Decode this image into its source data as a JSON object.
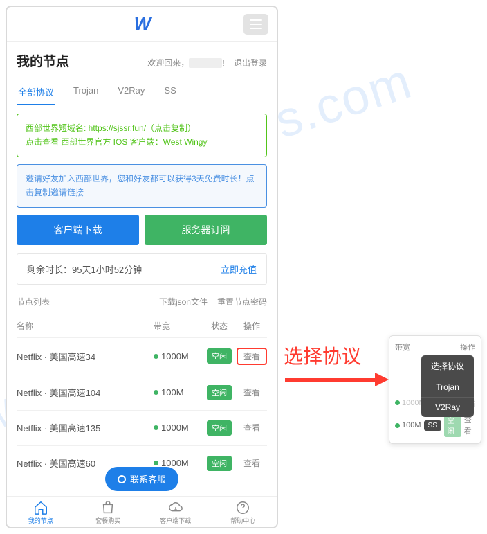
{
  "header": {
    "logo_text": "W"
  },
  "page": {
    "title": "我的节点",
    "welcome_prefix": "欢迎回来，",
    "logout": "退出登录"
  },
  "tabs": [
    {
      "label": "全部协议",
      "active": true
    },
    {
      "label": "Trojan",
      "active": false
    },
    {
      "label": "V2Ray",
      "active": false
    },
    {
      "label": "SS",
      "active": false
    }
  ],
  "info_green": {
    "line1_prefix": "西部世界短域名: ",
    "line1_link": "https://sjssr.fun/",
    "line1_suffix": "（点击复制）",
    "line2": "点击查看 西部世界官方 IOS 客户端：West Wingy"
  },
  "info_blue": "邀请好友加入西部世界，您和好友都可以获得3天免费时长！点击复制邀请链接",
  "buttons": {
    "download": "客户端下载",
    "subscribe": "服务器订阅"
  },
  "balance": {
    "label": "剩余时长：",
    "value": "95天1小时52分钟",
    "action": "立即充值"
  },
  "list": {
    "title": "节点列表",
    "link_json": "下载json文件",
    "link_reset": "重置节点密码",
    "col_name": "名称",
    "col_bw": "带宽",
    "col_status": "状态",
    "col_action": "操作",
    "status_idle": "空闲",
    "view": "查看",
    "nodes": [
      {
        "name": "Netflix · 美国高速34",
        "bw": "1000M",
        "highlight": true
      },
      {
        "name": "Netflix · 美国高速104",
        "bw": "100M",
        "highlight": false
      },
      {
        "name": "Netflix · 美国高速135",
        "bw": "1000M",
        "highlight": false
      },
      {
        "name": "Netflix · 美国高速60",
        "bw": "1000M",
        "highlight": false
      }
    ]
  },
  "contact": "联系客服",
  "bottom_nav": [
    {
      "label": "我的节点",
      "active": true
    },
    {
      "label": "套餐购买",
      "active": false
    },
    {
      "label": "客户端下载",
      "active": false
    },
    {
      "label": "帮助中心",
      "active": false
    }
  ],
  "annotation": {
    "label": "选择协议"
  },
  "popup": {
    "col_bw": "带宽",
    "col_action": "操作",
    "dropdown_title": "选择协议",
    "options": [
      "Trojan",
      "V2Ray",
      "SS"
    ],
    "row1_bw": "1000M",
    "row2_bw": "100M",
    "row2_status": "空闲",
    "ss_badge": "SS",
    "view": "查看"
  }
}
